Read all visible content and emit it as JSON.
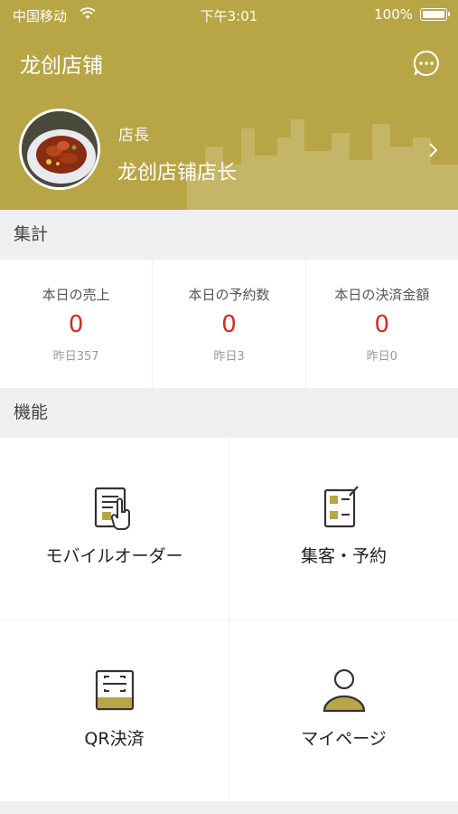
{
  "status_bar": {
    "carrier": "中国移动",
    "time": "下午3:01",
    "battery": "100%"
  },
  "header": {
    "title": "龙创店铺",
    "chat_icon": "chat-bubble-icon",
    "role": "店長",
    "store_owner": "龙创店铺店长"
  },
  "sections": {
    "summary": "集計",
    "features": "機能"
  },
  "stats": [
    {
      "label": "本日の売上",
      "value": "0",
      "yesterday": "昨日357"
    },
    {
      "label": "本日の予約数",
      "value": "0",
      "yesterday": "昨日3"
    },
    {
      "label": "本日の決済金額",
      "value": "0",
      "yesterday": "昨日0"
    }
  ],
  "features": [
    {
      "label": "モバイルオーダー",
      "icon": "mobile-order-icon"
    },
    {
      "label": "集客・予約",
      "icon": "reservation-icon"
    },
    {
      "label": "QR決済",
      "icon": "qr-scan-icon"
    },
    {
      "label": "マイページ",
      "icon": "user-icon"
    }
  ],
  "colors": {
    "brand": "#b8a545",
    "value_red": "#d32b20",
    "icon_gold": "#b8a545"
  }
}
